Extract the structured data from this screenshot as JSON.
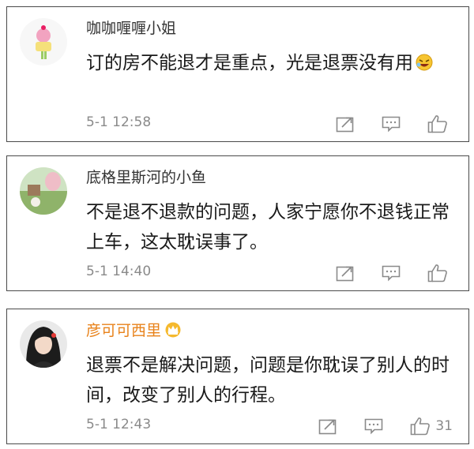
{
  "comments": [
    {
      "username": "咖咖喱喱小姐",
      "text": "订的房不能退才是重点，光是退票没有用",
      "time": "5-1 12:58",
      "likes": ""
    },
    {
      "username": "底格里斯河的小鱼",
      "text": "不是退不退款的问题，人家宁愿你不退钱正常上车，这太耽误事了。",
      "time": "5-1 14:40",
      "likes": ""
    },
    {
      "username": "彦可可西里",
      "text": "退票不是解决问题，问题是你耽误了别人的时间，改变了别人的行程。",
      "time": "5-1 12:43",
      "likes": "31"
    }
  ],
  "icons": {
    "share": "share-icon",
    "comment": "comment-icon",
    "like": "thumbs-up-icon",
    "vip": "crown-badge-icon",
    "emoji": "laughing-emoji-icon"
  },
  "colors": {
    "vip_name": "#e8821a",
    "meta_gray": "#8a8a8a",
    "border": "#4a4a4a"
  }
}
